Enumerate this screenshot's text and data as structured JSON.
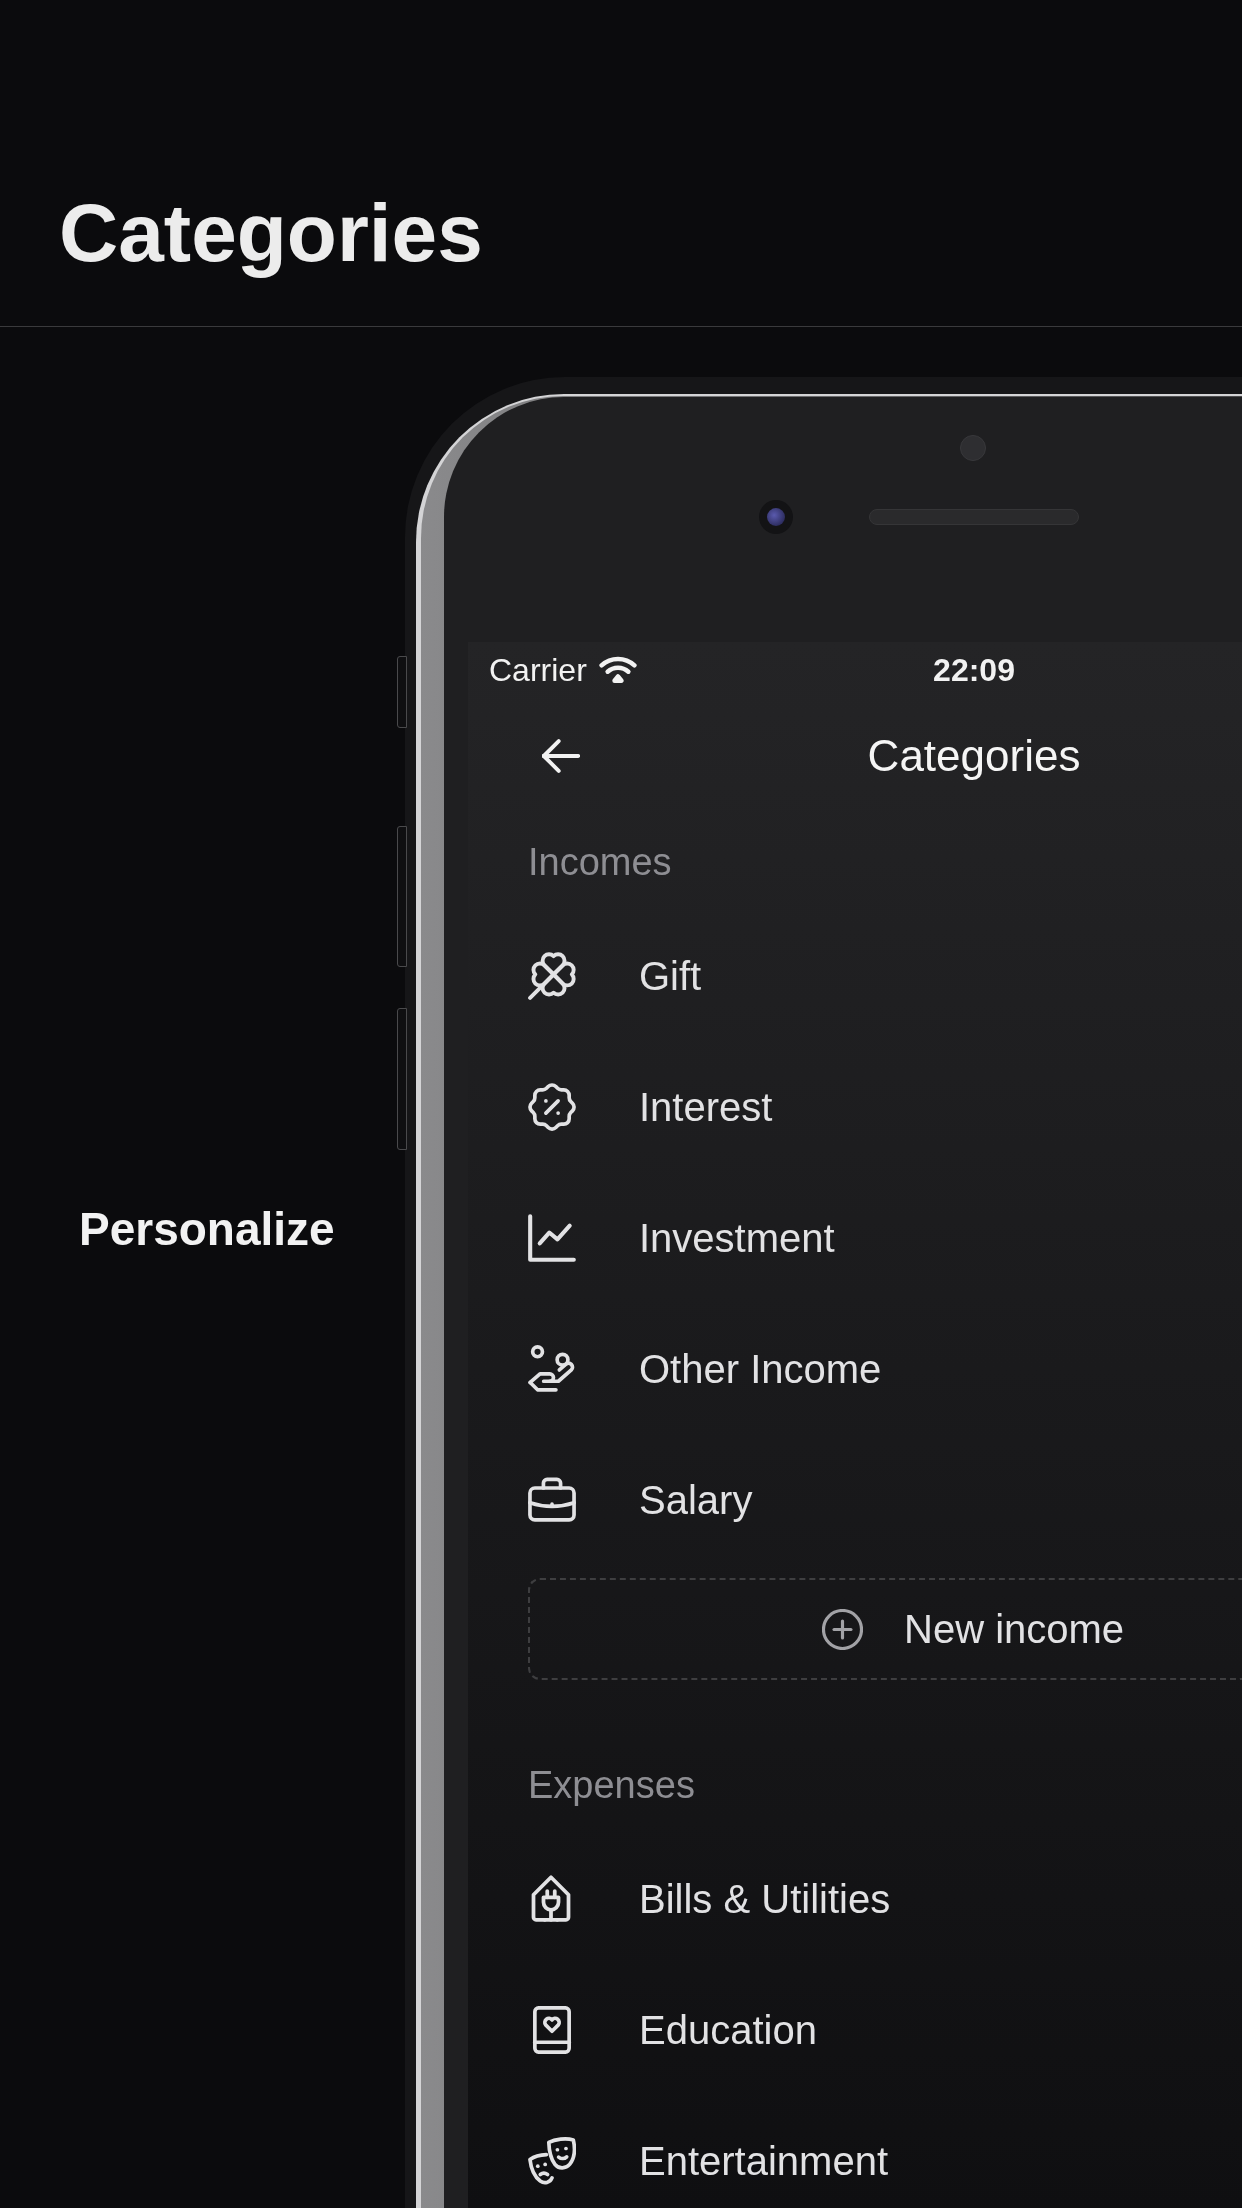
{
  "header": {
    "title": "Categories"
  },
  "caption": "Personalize",
  "phone": {
    "status_bar": {
      "carrier": "Carrier",
      "time": "22:09"
    },
    "nav_bar": {
      "title": "Categories"
    },
    "sections": [
      {
        "label": "Incomes",
        "items": [
          {
            "name": "Gift"
          },
          {
            "name": "Interest"
          },
          {
            "name": "Investment"
          },
          {
            "name": "Other Income"
          },
          {
            "name": "Salary"
          }
        ],
        "add_button": {
          "label": "New income"
        }
      },
      {
        "label": "Expenses",
        "items": [
          {
            "name": "Bills & Utilities"
          },
          {
            "name": "Education"
          },
          {
            "name": "Entertainment"
          }
        ]
      }
    ]
  }
}
